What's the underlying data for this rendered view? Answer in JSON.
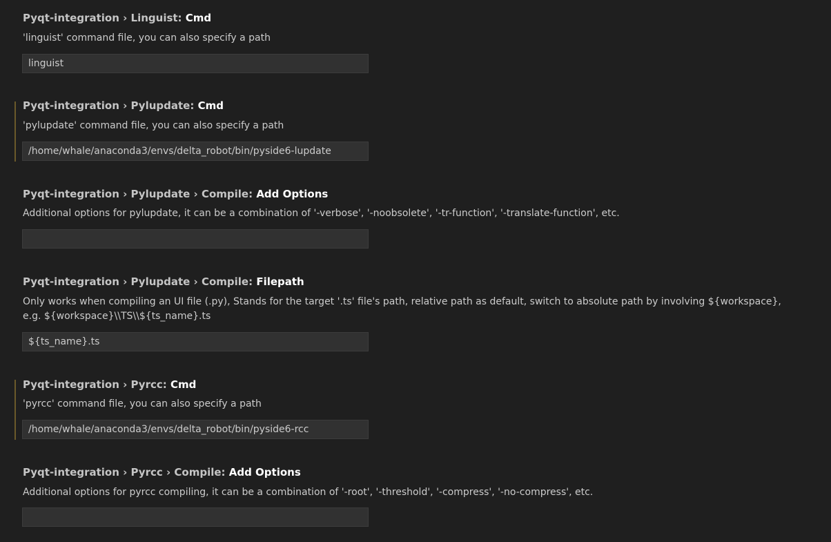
{
  "settings": [
    {
      "category": "Pyqt-integration › Linguist: ",
      "key": "Cmd",
      "description": "'linguist' command file, you can also specify a path",
      "value": "linguist"
    },
    {
      "category": "Pyqt-integration › Pylupdate: ",
      "key": "Cmd",
      "description": "'pylupdate' command file, you can also specify a path",
      "value": "/home/whale/anaconda3/envs/delta_robot/bin/pyside6-lupdate"
    },
    {
      "category": "Pyqt-integration › Pylupdate › Compile: ",
      "key": "Add Options",
      "description": "Additional options for pylupdate, it can be a combination of '-verbose', '-noobsolete', '-tr-function', '-translate-function', etc.",
      "value": ""
    },
    {
      "category": "Pyqt-integration › Pylupdate › Compile: ",
      "key": "Filepath",
      "description": "Only works when compiling an UI file (.py), Stands for the target '.ts' file's path, relative path as default, switch to absolute path by involving ${workspace}, e.g. ${workspace}\\\\TS\\\\${ts_name}.ts",
      "value": "${ts_name}.ts"
    },
    {
      "category": "Pyqt-integration › Pyrcc: ",
      "key": "Cmd",
      "description": "'pyrcc' command file, you can also specify a path",
      "value": "/home/whale/anaconda3/envs/delta_robot/bin/pyside6-rcc"
    },
    {
      "category": "Pyqt-integration › Pyrcc › Compile: ",
      "key": "Add Options",
      "description": "Additional options for pyrcc compiling, it can be a combination of '-root', '-threshold', '-compress', '-no-compress', etc.",
      "value": ""
    }
  ]
}
